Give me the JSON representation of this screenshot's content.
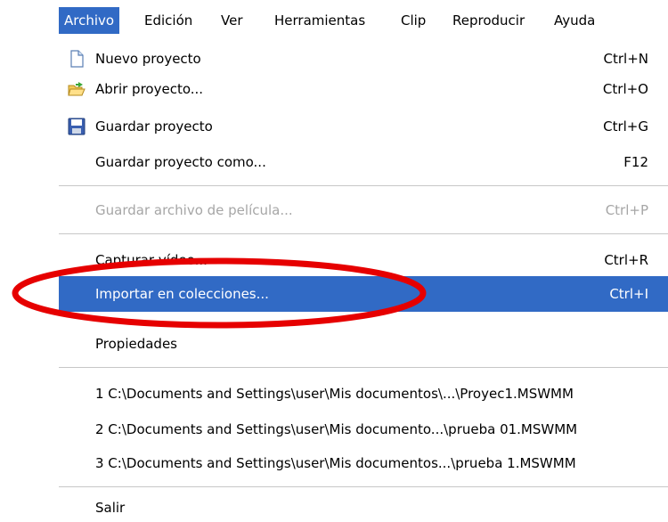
{
  "menubar": {
    "items": [
      {
        "label": "Archivo",
        "active": true
      },
      {
        "label": "Edición"
      },
      {
        "label": "Ver"
      },
      {
        "label": "Herramientas"
      },
      {
        "label": "Clip"
      },
      {
        "label": "Reproducir"
      },
      {
        "label": "Ayuda"
      }
    ]
  },
  "menu": {
    "items": [
      {
        "label": "Nuevo proyecto",
        "shortcut": "Ctrl+N",
        "icon": "new-document-icon"
      },
      {
        "label": "Abrir proyecto...",
        "shortcut": "Ctrl+O",
        "icon": "open-folder-icon"
      },
      {
        "label": "Guardar proyecto",
        "shortcut": "Ctrl+G",
        "icon": "floppy-disk-icon"
      },
      {
        "label": "Guardar proyecto como...",
        "shortcut": "F12"
      },
      {
        "label": "Guardar archivo de película...",
        "shortcut": "Ctrl+P",
        "disabled": true
      },
      {
        "label": "Capturar vídeo...",
        "shortcut": "Ctrl+R"
      },
      {
        "label": "Importar en colecciones...",
        "shortcut": "Ctrl+I",
        "highlighted": true
      },
      {
        "label": "Propiedades"
      },
      {
        "label": "1 C:\\Documents and Settings\\user\\Mis documentos\\...\\Proyec1.MSWMM"
      },
      {
        "label": "2 C:\\Documents and Settings\\user\\Mis documento...\\prueba 01.MSWMM"
      },
      {
        "label": "3 C:\\Documents and Settings\\user\\Mis documentos...\\prueba 1.MSWMM"
      },
      {
        "label": "Salir"
      }
    ]
  },
  "colors": {
    "highlight": "#316ac5",
    "disabled_text": "#a6a6a6",
    "annotation_ellipse": "#e60000"
  }
}
